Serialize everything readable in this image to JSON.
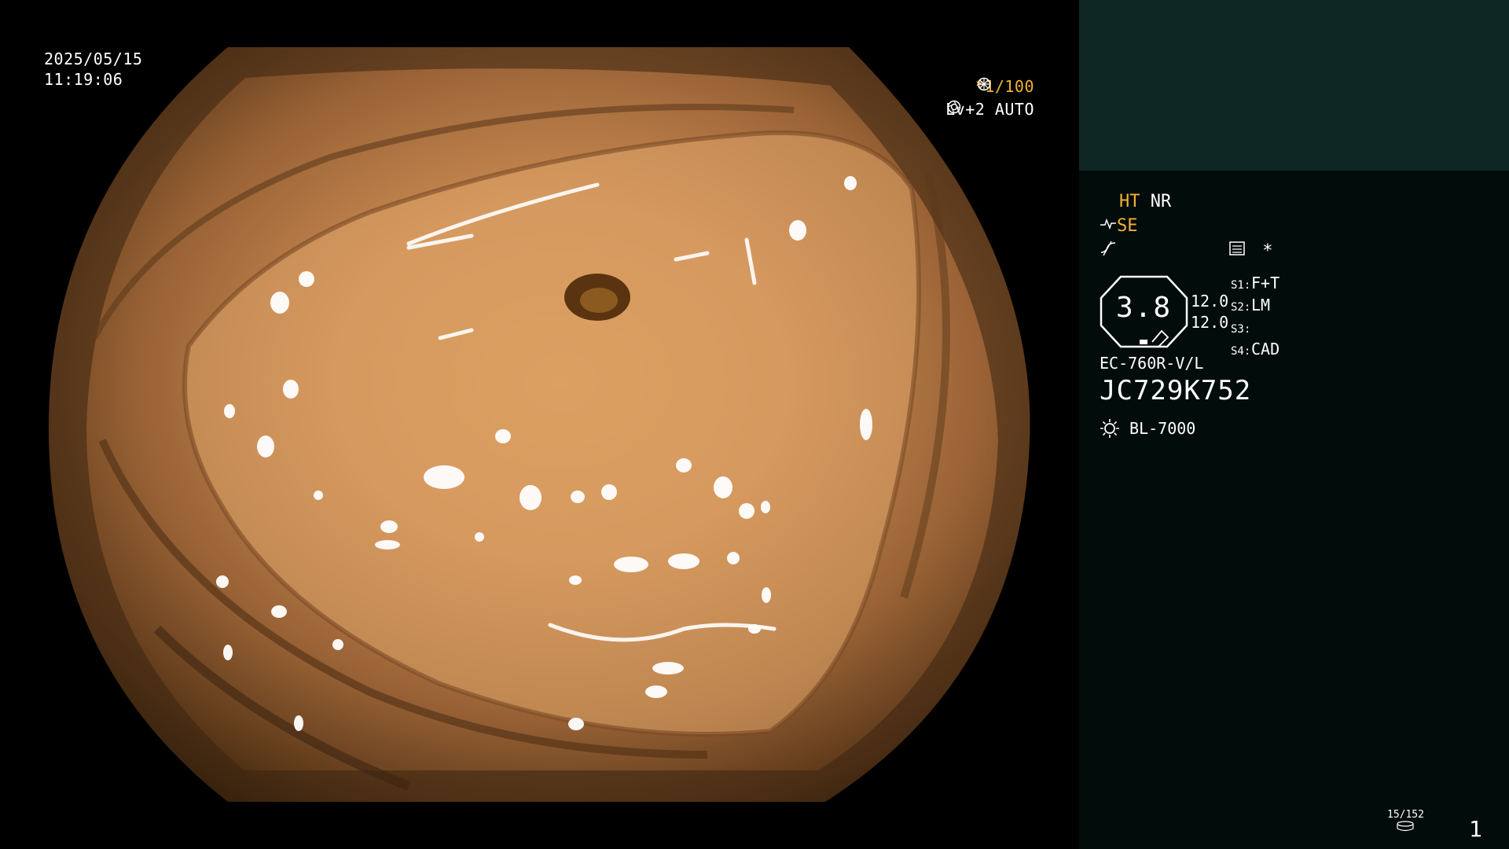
{
  "overlay": {
    "date": "2025/05/15",
    "time": "11:19:06",
    "shutter": "*1/100",
    "shutter_icon": "shutter-dial-icon",
    "level": "Lv+2 AUTO",
    "level_icon": "iris-auto-icon"
  },
  "panel": {
    "ht": "HT",
    "nr": "NR",
    "se": "SE",
    "se_icon": "sharpness-icon",
    "edge_icon": "edge-enhance-icon",
    "mode_icon": "record-mode-icon",
    "mode_star": "*",
    "zoom_value": "3.8",
    "gains": [
      "12.0",
      "12.0"
    ],
    "switches": [
      {
        "key": "S1:",
        "value": "F+T"
      },
      {
        "key": "S2:",
        "value": "LM"
      },
      {
        "key": "S3:",
        "value": ""
      },
      {
        "key": "S4:",
        "value": "CAD"
      }
    ],
    "scope_model": "EC-760R-V/L",
    "scope_serial": "JC729K752",
    "light_source_icon": "light-source-icon",
    "light_source": "BL-7000",
    "counter": "15/152",
    "counter_icon": "storage-icon",
    "page_number": "1"
  },
  "colors": {
    "accent": "#f2b132",
    "panel_bg": "#020c0b",
    "thumb_bg": "#0e2624"
  }
}
